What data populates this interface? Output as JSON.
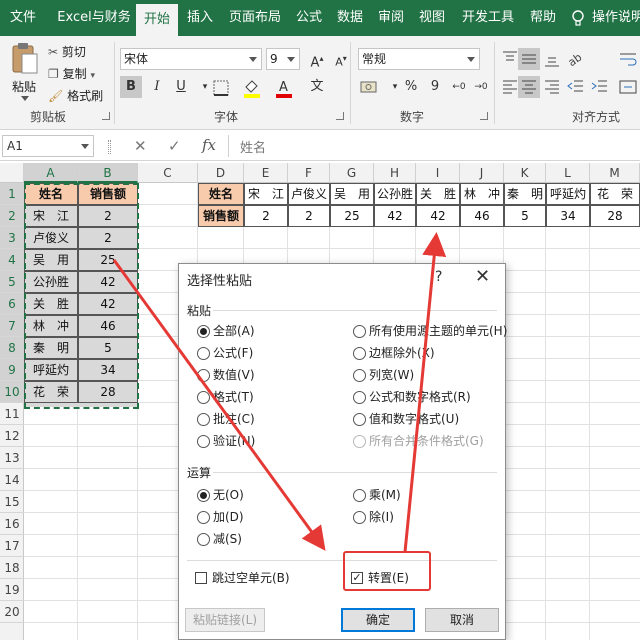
{
  "ribbon": {
    "tabs": [
      "文件",
      "Excel与财务",
      "开始",
      "插入",
      "页面布局",
      "公式",
      "数据",
      "审阅",
      "视图",
      "开发工具",
      "帮助"
    ],
    "active_tab": "开始",
    "tell_me": "操作说明",
    "clipboard": {
      "paste": "粘贴",
      "cut": "剪切",
      "copy": "复制",
      "format_painter": "格式刷",
      "group": "剪贴板"
    },
    "font": {
      "name": "宋体",
      "size": "9",
      "bold": "B",
      "italic": "I",
      "underline": "U",
      "grow": "A",
      "shrink": "A",
      "group": "字体"
    },
    "number": {
      "format": "常规",
      "percent": "%",
      "comma": "9",
      "group": "数字"
    },
    "alignment": {
      "group": "对齐方式"
    }
  },
  "formula_bar": {
    "name_box": "A1",
    "cancel": "✕",
    "enter": "✓",
    "fx": "fx",
    "content": "姓名"
  },
  "grid": {
    "columns": [
      "A",
      "B",
      "C",
      "D",
      "E",
      "F",
      "G",
      "H",
      "I",
      "J",
      "K",
      "L",
      "M"
    ],
    "rows": [
      "1",
      "2",
      "3",
      "4",
      "5",
      "6",
      "7",
      "8",
      "9",
      "10",
      "11",
      "12",
      "13",
      "14",
      "15",
      "16",
      "17",
      "18",
      "19",
      "20"
    ],
    "source": {
      "header_name": "姓名",
      "header_sales": "销售额",
      "names": [
        "宋　江",
        "卢俊义",
        "吴　用",
        "公孙胜",
        "关　胜",
        "林　冲",
        "秦　明",
        "呼延灼",
        "花　荣"
      ],
      "sales": [
        "2",
        "2",
        "25",
        "42",
        "42",
        "46",
        "5",
        "34",
        "28"
      ]
    },
    "transposed": {
      "row1_label": "姓名",
      "row2_label": "销售额",
      "names": [
        "宋　江",
        "卢俊义",
        "吴　用",
        "公孙胜",
        "关　胜",
        "林　冲",
        "秦　明",
        "呼延灼",
        "花　荣"
      ],
      "sales": [
        "2",
        "2",
        "25",
        "42",
        "42",
        "46",
        "5",
        "34",
        "28"
      ]
    }
  },
  "dialog": {
    "title": "选择性粘贴",
    "help": "?",
    "close": "✕",
    "paste_section": "粘贴",
    "paste_options_left": [
      "全部(A)",
      "公式(F)",
      "数值(V)",
      "格式(T)",
      "批注(C)",
      "验证(N)"
    ],
    "paste_options_right": [
      "所有使用源主题的单元(H)",
      "边框除外(X)",
      "列宽(W)",
      "公式和数字格式(R)",
      "值和数字格式(U)",
      "所有合并条件格式(G)"
    ],
    "paste_selected": "全部(A)",
    "operation_section": "运算",
    "operation_left": [
      "无(O)",
      "加(D)",
      "减(S)"
    ],
    "operation_right": [
      "乘(M)",
      "除(I)"
    ],
    "operation_selected": "无(O)",
    "skip_blanks": "跳过空单元(B)",
    "transpose": "转置(E)",
    "transpose_checked": true,
    "check_mark": "✓",
    "paste_link": "粘贴链接(L)",
    "ok": "确定",
    "cancel": "取消"
  },
  "colors": {
    "excel_green": "#217346",
    "header_fill": "#f8cbad",
    "selection_fill": "#d9d9d9",
    "annotation_red": "#e53935"
  }
}
